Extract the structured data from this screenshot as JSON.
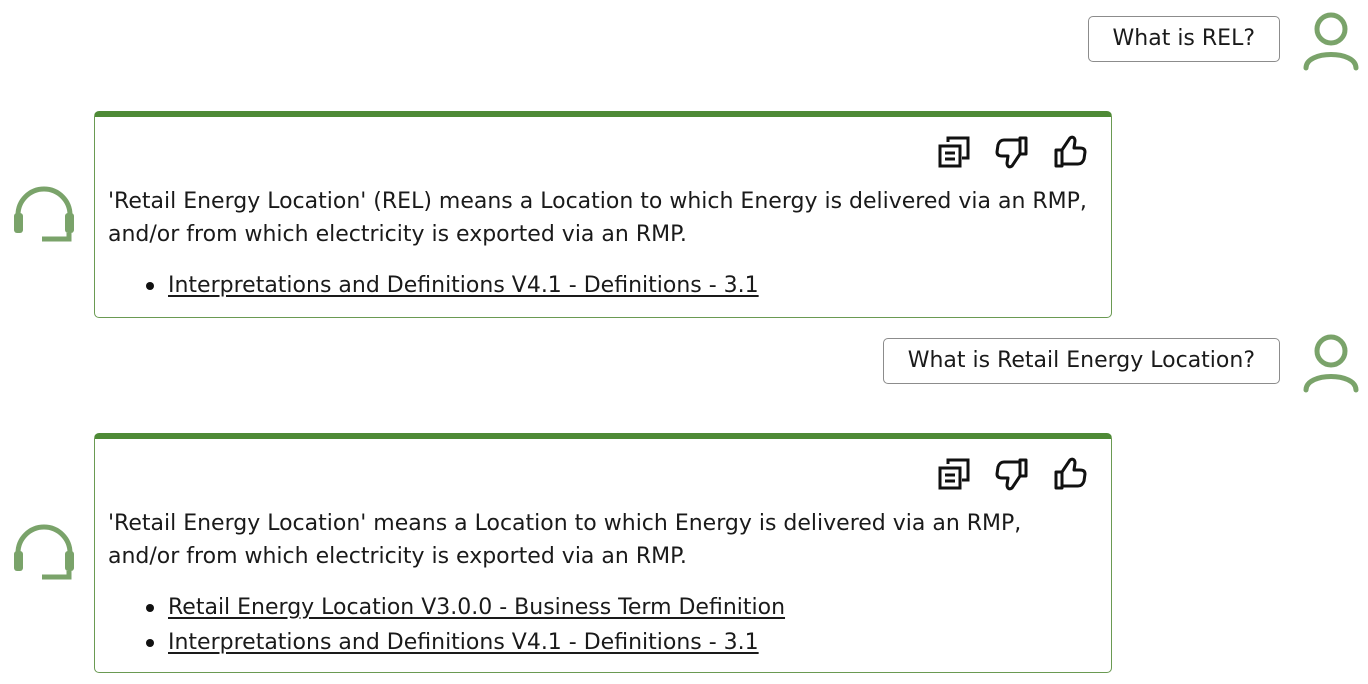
{
  "colors": {
    "accent_green": "#4e8a36",
    "avatar_green": "#7aa36a",
    "card_border": "#6a9a52",
    "user_bubble_border": "#8c8c8c"
  },
  "messages": [
    {
      "role": "user",
      "text": "What is REL?",
      "avatar_icon": "person-icon"
    },
    {
      "role": "assistant",
      "avatar_icon": "headset-icon",
      "actions": [
        "copy-icon",
        "thumbs-down-icon",
        "thumbs-up-icon"
      ],
      "text": "'Retail Energy Location' (REL) means a Location to which Energy is delivered via an RMP, and/or from which electricity is exported via an RMP.",
      "sources": [
        "Interpretations and Definitions V4.1 - Definitions - 3.1"
      ]
    },
    {
      "role": "user",
      "text": "What is Retail Energy Location?",
      "avatar_icon": "person-icon"
    },
    {
      "role": "assistant",
      "avatar_icon": "headset-icon",
      "actions": [
        "copy-icon",
        "thumbs-down-icon",
        "thumbs-up-icon"
      ],
      "text": "'Retail Energy Location' means a Location to which Energy is delivered via an RMP, and/or from which electricity is exported via an RMP.",
      "sources": [
        "Retail Energy Location V3.0.0 - Business Term Definition",
        "Interpretations and Definitions V4.1 - Definitions - 3.1"
      ]
    }
  ]
}
